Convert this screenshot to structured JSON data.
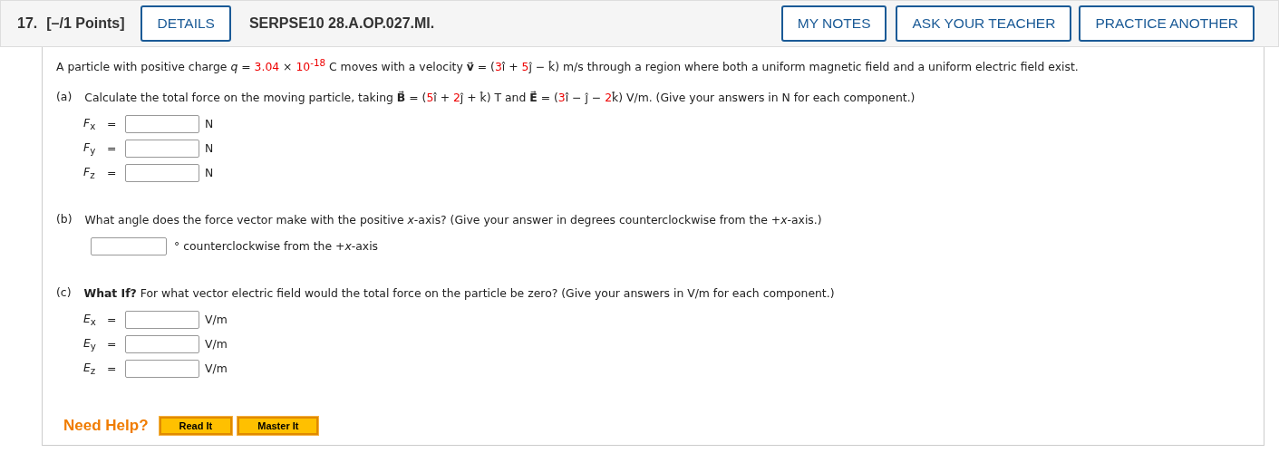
{
  "header": {
    "number": "17.",
    "points": "[–/1 Points]",
    "details_button": "DETAILS",
    "code": "SERPSE10 28.A.OP.027.MI.",
    "buttons": [
      "MY NOTES",
      "ASK YOUR TEACHER",
      "PRACTICE ANOTHER"
    ]
  },
  "intro": [
    {
      "kind": "text",
      "text": "A particle with positive charge "
    },
    {
      "kind": "var",
      "text": "q"
    },
    {
      "kind": "text",
      "text": " = "
    },
    {
      "kind": "value",
      "text": "3.04"
    },
    {
      "kind": "text",
      "text": " × "
    },
    {
      "kind": "value",
      "text": "10$^{-18}$"
    },
    {
      "kind": "text",
      "text": " C moves with a velocity "
    },
    {
      "kind": "vector",
      "text": "v⃗"
    },
    {
      "kind": "text",
      "text": " = ("
    },
    {
      "kind": "value",
      "text": "3"
    },
    {
      "kind": "text",
      "text": "î + "
    },
    {
      "kind": "value",
      "text": "5"
    },
    {
      "kind": "text",
      "text": "ĵ − k̂) m/s through a region where both a uniform magnetic field and a uniform electric field exist."
    }
  ],
  "parts": [
    {
      "label": "(a)",
      "kind": "components",
      "prompt": [
        {
          "kind": "text",
          "text": "Calculate the total force on the moving particle, taking "
        },
        {
          "kind": "vector",
          "text": "B⃗"
        },
        {
          "kind": "text",
          "text": " = ("
        },
        {
          "kind": "value",
          "text": "5"
        },
        {
          "kind": "text",
          "text": "î + "
        },
        {
          "kind": "value",
          "text": "2"
        },
        {
          "kind": "text",
          "text": "ĵ + k̂) T and "
        },
        {
          "kind": "vector",
          "text": "E⃗"
        },
        {
          "kind": "text",
          "text": " = ("
        },
        {
          "kind": "value",
          "text": "3"
        },
        {
          "kind": "text",
          "text": "î − ĵ − "
        },
        {
          "kind": "value",
          "text": "2"
        },
        {
          "kind": "text",
          "text": "k̂) V/m. (Give your answers in N for each component.)"
        }
      ],
      "rows": [
        {
          "symbol": "*F*$_{x}$",
          "equals": "=",
          "unit": "N"
        },
        {
          "symbol": "*F*$_{y}$",
          "equals": "=",
          "unit": "N"
        },
        {
          "symbol": "*F*$_{z}$",
          "equals": "=",
          "unit": "N"
        }
      ]
    },
    {
      "label": "(b)",
      "kind": "angle",
      "prompt": [
        {
          "kind": "text",
          "text": "What angle does the force vector make with the positive *x*-axis? (Give your answer in degrees counterclockwise from the +*x*-axis.)"
        }
      ],
      "rows": [
        {
          "unit": "° counterclockwise from the +*x*-axis"
        }
      ]
    },
    {
      "label": "(c)",
      "kind": "components",
      "prompt": [
        {
          "kind": "text",
          "text": "**What If?** For what vector electric field would the total force on the particle be zero? (Give your answers in V/m for each component.)"
        }
      ],
      "rows": [
        {
          "symbol": "*E*$_{x}$",
          "equals": "=",
          "unit": "V/m"
        },
        {
          "symbol": "*E*$_{y}$",
          "equals": "=",
          "unit": "V/m"
        },
        {
          "symbol": "*E*$_{z}$",
          "equals": "=",
          "unit": "V/m"
        }
      ]
    }
  ],
  "help": {
    "label": "Need Help?",
    "buttons": [
      "Read It",
      "Master It"
    ]
  }
}
